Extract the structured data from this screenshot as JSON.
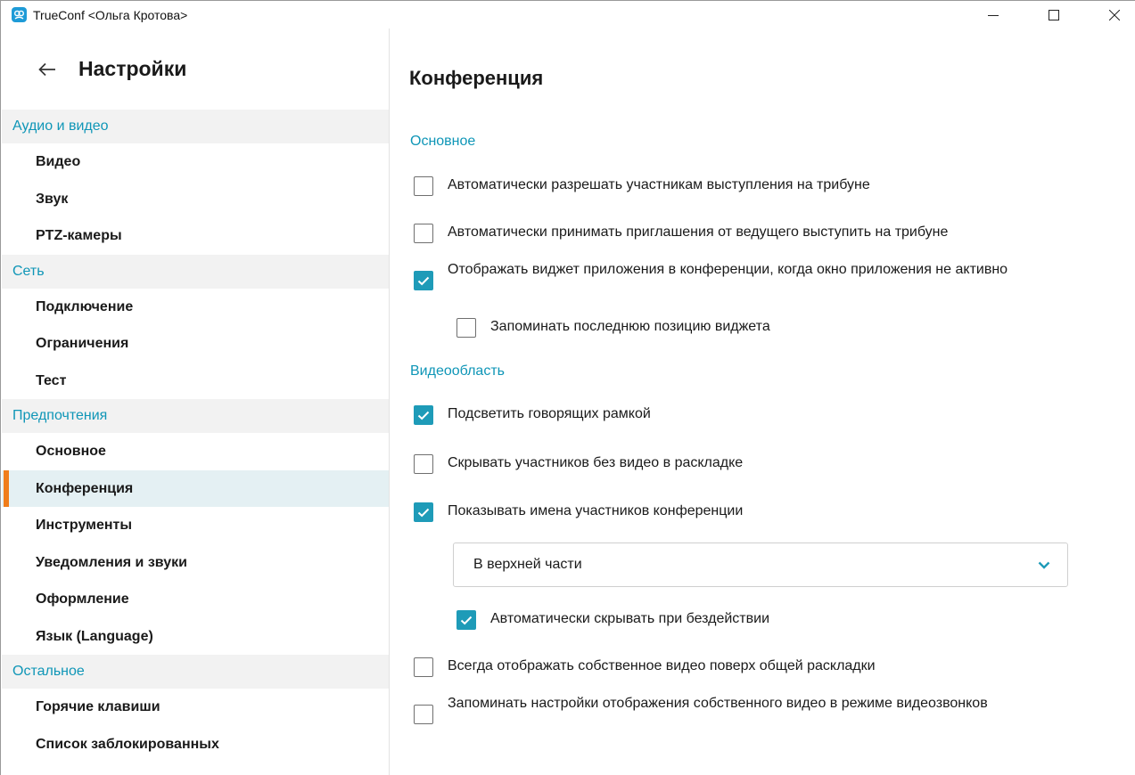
{
  "window": {
    "title": "TrueConf <Ольга Кротова>",
    "colors": {
      "accent": "#1e9bb8",
      "section_text": "#0f96b7",
      "active_marker": "#f07d1b",
      "active_bg": "#e4f0f3"
    }
  },
  "sidebar": {
    "title": "Настройки",
    "back_icon": "arrow-left-icon",
    "sections": [
      {
        "label": "Аудио и видео",
        "items": [
          "Видео",
          "Звук",
          "PTZ-камеры"
        ]
      },
      {
        "label": "Сеть",
        "items": [
          "Подключение",
          "Ограничения",
          "Тест"
        ]
      },
      {
        "label": "Предпочтения",
        "items": [
          "Основное",
          "Конференция",
          "Инструменты",
          "Уведомления и звуки",
          "Оформление",
          "Язык (Language)"
        ]
      },
      {
        "label": "Остальное",
        "items": [
          "Горячие клавиши",
          "Список заблокированных"
        ]
      }
    ],
    "active_item": "Конференция"
  },
  "main": {
    "title": "Конференция",
    "groups": {
      "basic": {
        "label": "Основное",
        "options": [
          {
            "label": "Автоматически разрешать участникам выступления на трибуне",
            "checked": false
          },
          {
            "label": "Автоматически принимать приглашения от ведущего выступить на трибуне",
            "checked": false
          },
          {
            "label": "Отображать виджет приложения в конференции, когда окно приложения не активно",
            "checked": true
          },
          {
            "label": "Запоминать последнюю позицию виджета",
            "checked": false
          }
        ]
      },
      "video": {
        "label": "Видеообласть",
        "options": [
          {
            "label": "Подсветить говорящих рамкой",
            "checked": true
          },
          {
            "label": "Скрывать участников без видео в раскладке",
            "checked": false
          },
          {
            "label": "Показывать имена участников конференции",
            "checked": true
          },
          {
            "label": "Автоматически скрывать при бездействии",
            "checked": true
          },
          {
            "label": "Всегда отображать собственное видео поверх общей раскладки",
            "checked": false
          },
          {
            "label": "Запоминать настройки отображения собственного видео в режиме видеозвонков",
            "checked": false
          }
        ],
        "name_position": {
          "selected": "В верхней части",
          "icon": "chevron-down-icon"
        }
      }
    }
  }
}
